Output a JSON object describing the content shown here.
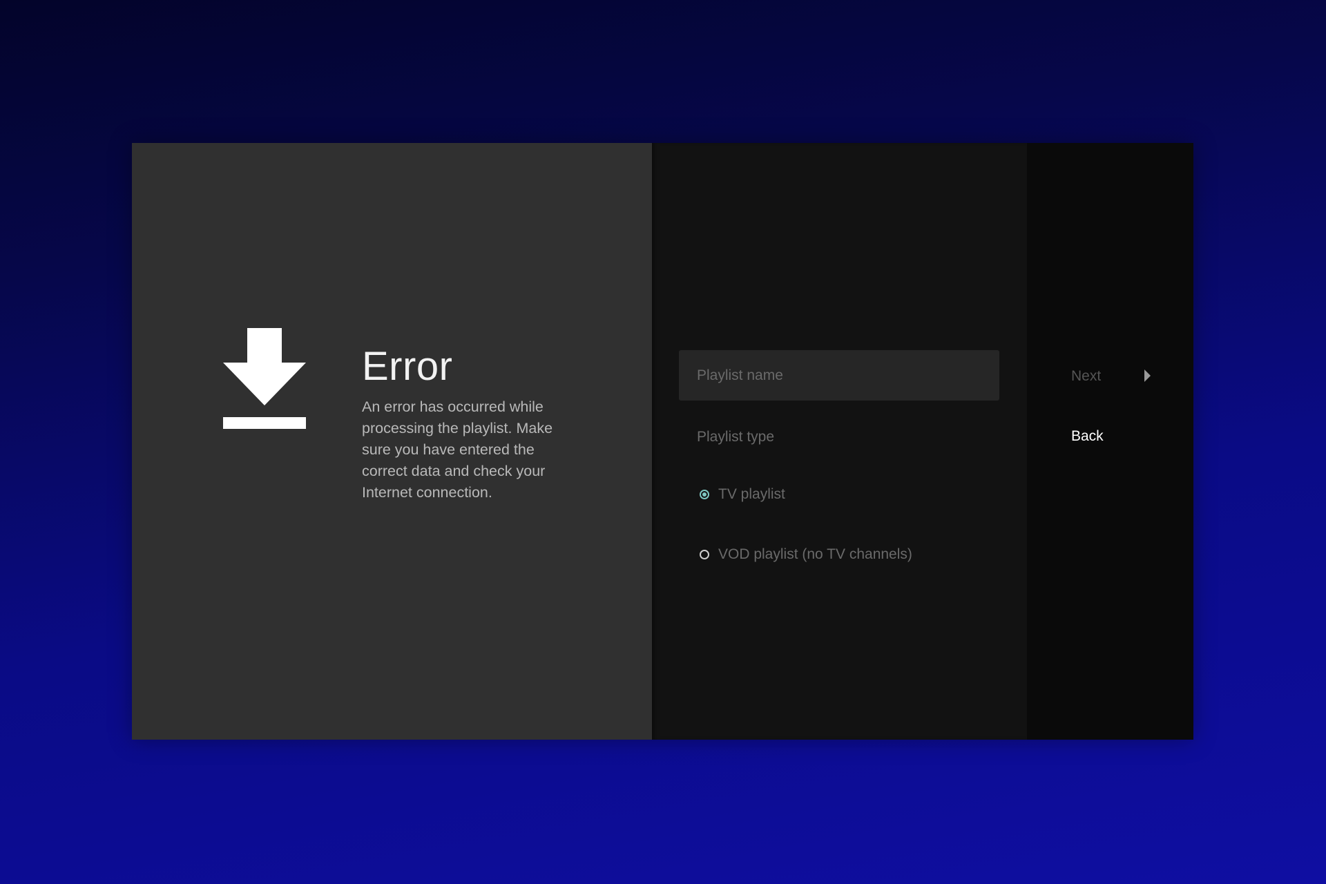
{
  "error": {
    "title": "Error",
    "message": "An error has occurred while processing the playlist. Make sure you have entered the correct data and check your Internet connection.",
    "icon": "download-icon"
  },
  "form": {
    "name_placeholder": "Playlist name",
    "name_value": "",
    "type_label": "Playlist type",
    "options": [
      {
        "label": "TV playlist",
        "selected": true
      },
      {
        "label": "VOD playlist (no TV channels)",
        "selected": false
      }
    ],
    "accent_color": "#7fc8c2"
  },
  "actions": {
    "next_label": "Next",
    "next_icon": "chevron-right-icon",
    "back_label": "Back"
  }
}
